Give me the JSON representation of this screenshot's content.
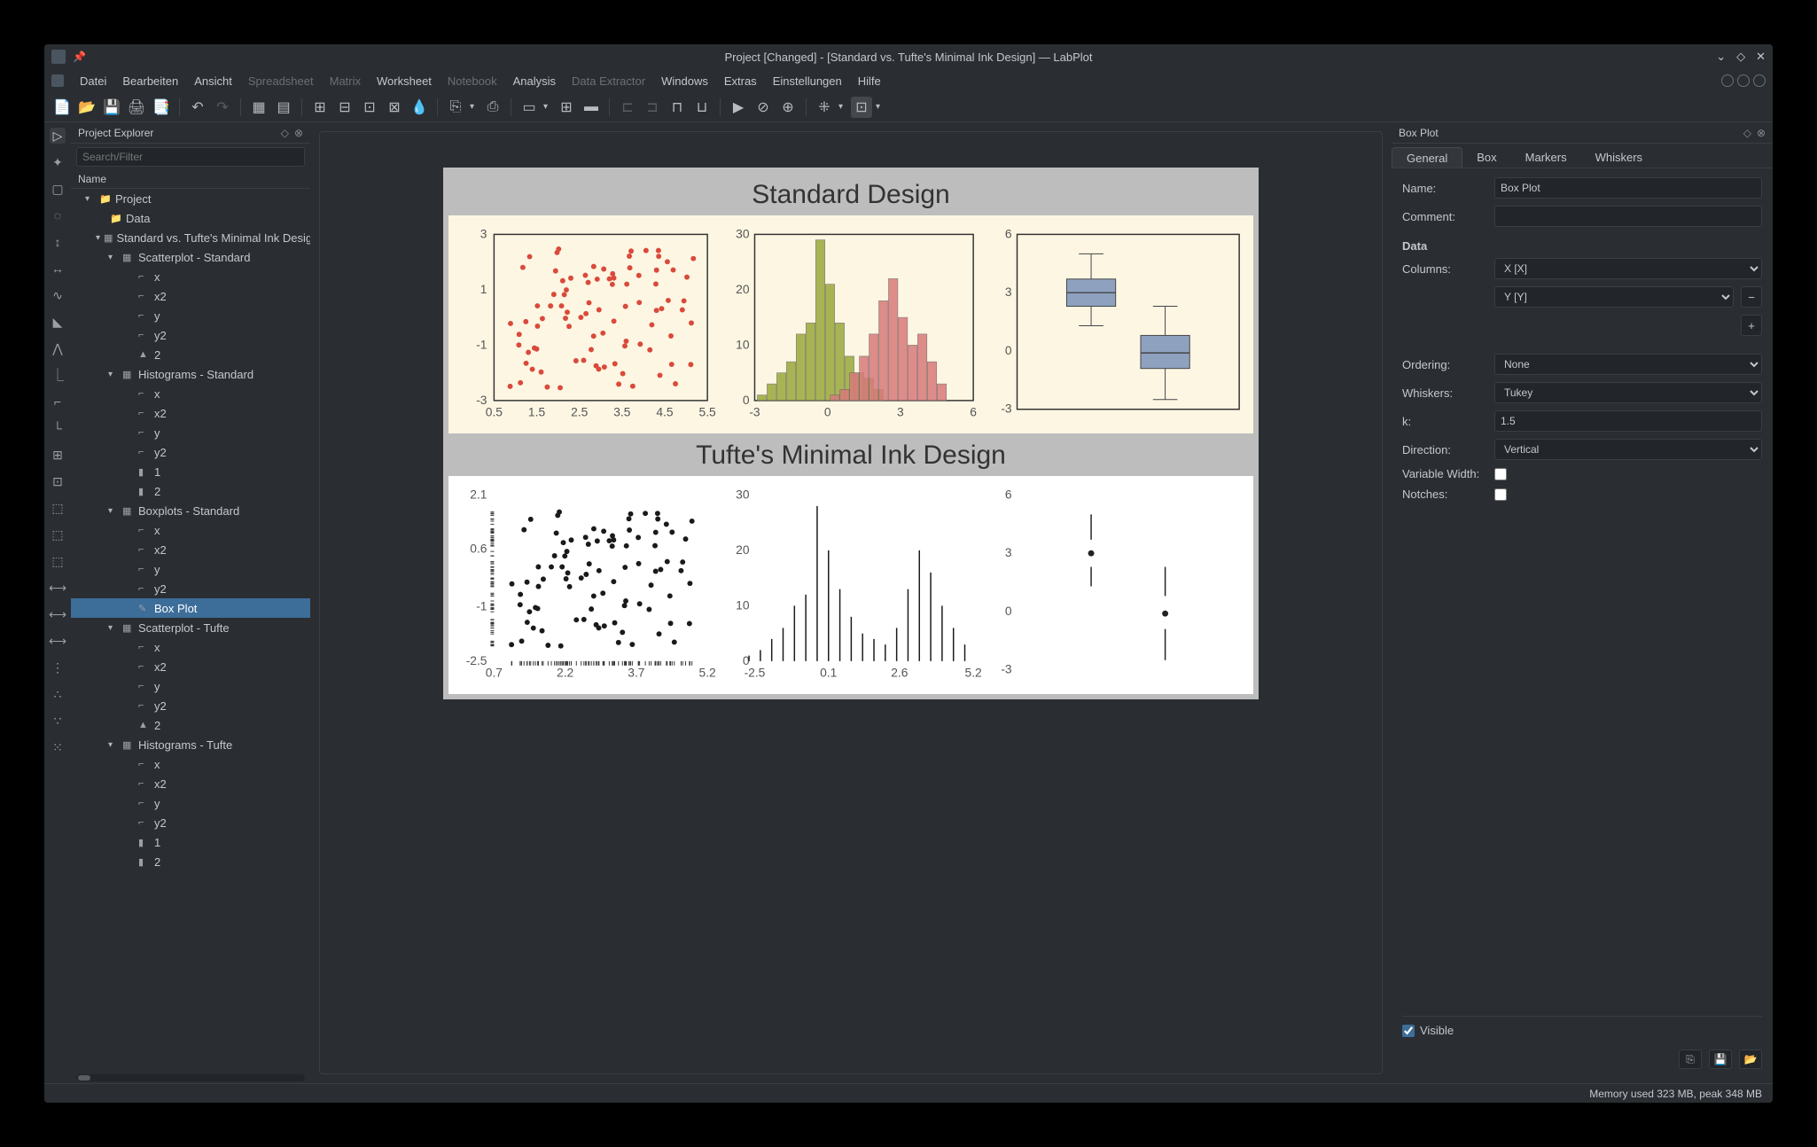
{
  "title": "Project [Changed] - [Standard vs. Tufte's Minimal Ink Design] — LabPlot",
  "menu": {
    "items": [
      "Datei",
      "Bearbeiten",
      "Ansicht",
      "Spreadsheet",
      "Matrix",
      "Worksheet",
      "Notebook",
      "Analysis",
      "Data Extractor",
      "Windows",
      "Extras",
      "Einstellungen",
      "Hilfe"
    ],
    "disabled": [
      3,
      4,
      6,
      8
    ]
  },
  "explorer": {
    "title": "Project Explorer",
    "search_placeholder": "Search/Filter",
    "header": "Name",
    "tree": [
      {
        "l": 1,
        "exp": "▾",
        "ico": "📁",
        "label": "Project"
      },
      {
        "l": 2,
        "exp": "",
        "ico": "📁",
        "label": "Data"
      },
      {
        "l": 2,
        "exp": "▾",
        "ico": "▦",
        "label": "Standard vs. Tufte's Minimal Ink Design"
      },
      {
        "l": 3,
        "exp": "▾",
        "ico": "▦",
        "label": "Scatterplot - Standard"
      },
      {
        "l": 4,
        "exp": "",
        "ico": "⌐",
        "label": "x"
      },
      {
        "l": 4,
        "exp": "",
        "ico": "⌐",
        "label": "x2"
      },
      {
        "l": 4,
        "exp": "",
        "ico": "⌐",
        "label": "y"
      },
      {
        "l": 4,
        "exp": "",
        "ico": "⌐",
        "label": "y2"
      },
      {
        "l": 4,
        "exp": "",
        "ico": "▲",
        "label": "2"
      },
      {
        "l": 3,
        "exp": "▾",
        "ico": "▦",
        "label": "Histograms - Standard"
      },
      {
        "l": 4,
        "exp": "",
        "ico": "⌐",
        "label": "x"
      },
      {
        "l": 4,
        "exp": "",
        "ico": "⌐",
        "label": "x2"
      },
      {
        "l": 4,
        "exp": "",
        "ico": "⌐",
        "label": "y"
      },
      {
        "l": 4,
        "exp": "",
        "ico": "⌐",
        "label": "y2"
      },
      {
        "l": 4,
        "exp": "",
        "ico": "▮",
        "label": "1"
      },
      {
        "l": 4,
        "exp": "",
        "ico": "▮",
        "label": "2"
      },
      {
        "l": 3,
        "exp": "▾",
        "ico": "▦",
        "label": "Boxplots - Standard"
      },
      {
        "l": 4,
        "exp": "",
        "ico": "⌐",
        "label": "x"
      },
      {
        "l": 4,
        "exp": "",
        "ico": "⌐",
        "label": "x2"
      },
      {
        "l": 4,
        "exp": "",
        "ico": "⌐",
        "label": "y"
      },
      {
        "l": 4,
        "exp": "",
        "ico": "⌐",
        "label": "y2"
      },
      {
        "l": 4,
        "exp": "",
        "ico": "✎",
        "label": "Box Plot",
        "selected": true
      },
      {
        "l": 3,
        "exp": "▾",
        "ico": "▦",
        "label": "Scatterplot - Tufte"
      },
      {
        "l": 4,
        "exp": "",
        "ico": "⌐",
        "label": "x"
      },
      {
        "l": 4,
        "exp": "",
        "ico": "⌐",
        "label": "x2"
      },
      {
        "l": 4,
        "exp": "",
        "ico": "⌐",
        "label": "y"
      },
      {
        "l": 4,
        "exp": "",
        "ico": "⌐",
        "label": "y2"
      },
      {
        "l": 4,
        "exp": "",
        "ico": "▲",
        "label": "2"
      },
      {
        "l": 3,
        "exp": "▾",
        "ico": "▦",
        "label": "Histograms - Tufte"
      },
      {
        "l": 4,
        "exp": "",
        "ico": "⌐",
        "label": "x"
      },
      {
        "l": 4,
        "exp": "",
        "ico": "⌐",
        "label": "x2"
      },
      {
        "l": 4,
        "exp": "",
        "ico": "⌐",
        "label": "y"
      },
      {
        "l": 4,
        "exp": "",
        "ico": "⌐",
        "label": "y2"
      },
      {
        "l": 4,
        "exp": "",
        "ico": "▮",
        "label": "1"
      },
      {
        "l": 4,
        "exp": "",
        "ico": "▮",
        "label": "2"
      }
    ]
  },
  "worksheet": {
    "title1": "Standard Design",
    "title2": "Tufte's Minimal Ink Design"
  },
  "chart_data": [
    {
      "type": "scatter",
      "title": "",
      "xlim": [
        0.5,
        5.5
      ],
      "ylim": [
        -3,
        3
      ],
      "xticks": [
        0.5,
        1.5,
        2.5,
        3.5,
        4.5,
        5.5
      ],
      "yticks": [
        -3,
        -1,
        1,
        3
      ],
      "color": "#d94a3a",
      "n": 90
    },
    {
      "type": "bar",
      "title": "",
      "xlim": [
        -3,
        6
      ],
      "ylim": [
        0,
        30
      ],
      "xticks": [
        -3,
        0,
        3,
        6
      ],
      "yticks": [
        0,
        10,
        20,
        30
      ],
      "series": [
        {
          "name": "1",
          "color": "#9aa83a",
          "x": [
            -2.7,
            -2.3,
            -1.9,
            -1.5,
            -1.1,
            -0.7,
            -0.3,
            0.1,
            0.5,
            0.9,
            1.3,
            1.7,
            2.1
          ],
          "values": [
            1,
            3,
            5,
            7,
            12,
            14,
            29,
            21,
            14,
            8,
            5,
            4,
            2
          ]
        },
        {
          "name": "2",
          "color": "#d87a7a",
          "x": [
            0.3,
            0.7,
            1.1,
            1.5,
            1.9,
            2.3,
            2.7,
            3.1,
            3.5,
            3.9,
            4.3,
            4.7
          ],
          "values": [
            1,
            2,
            5,
            8,
            12,
            18,
            22,
            15,
            10,
            12,
            7,
            3
          ]
        }
      ]
    },
    {
      "type": "box",
      "title": "",
      "xlim": [
        0,
        3
      ],
      "ylim": [
        -3,
        6
      ],
      "yticks": [
        -3,
        0,
        3,
        6
      ],
      "boxes": [
        {
          "pos": 1,
          "min": 1.3,
          "q1": 2.3,
          "med": 3.0,
          "q3": 3.7,
          "max": 5.0,
          "color": "#8ea2c0"
        },
        {
          "pos": 2,
          "min": -2.5,
          "q1": -0.9,
          "med": -0.1,
          "q3": 0.8,
          "max": 2.3,
          "color": "#8ea2c0"
        }
      ]
    },
    {
      "type": "scatter",
      "title": "",
      "xlim": [
        0.7,
        5.2
      ],
      "ylim": [
        -2.5,
        2.1
      ],
      "xticks": [
        0.7,
        2.2,
        3.7,
        5.2
      ],
      "yticks": [
        -2.5,
        -1.0,
        0.6,
        2.1
      ],
      "color": "#1a1a1a",
      "n": 90,
      "rug": true
    },
    {
      "type": "bar",
      "title": "",
      "xlim": [
        -2.5,
        5.2
      ],
      "ylim": [
        0,
        30
      ],
      "xticks": [
        -2.5,
        0.1,
        2.6,
        5.2
      ],
      "yticks": [
        0,
        10,
        20,
        30
      ],
      "style": "line",
      "series": [
        {
          "name": "1",
          "color": "#1a1a1a",
          "x": [
            -2.7,
            -2.3,
            -1.9,
            -1.5,
            -1.1,
            -0.7,
            -0.3,
            0.1,
            0.5,
            0.9,
            1.3,
            1.7,
            2.1,
            2.5,
            2.9,
            3.3,
            3.7,
            4.1,
            4.5,
            4.9
          ],
          "values": [
            1,
            2,
            4,
            6,
            10,
            12,
            28,
            20,
            13,
            8,
            5,
            4,
            3,
            6,
            13,
            20,
            16,
            10,
            6,
            3
          ]
        }
      ]
    },
    {
      "type": "box",
      "title": "",
      "xlim": [
        0,
        3
      ],
      "ylim": [
        -3,
        6
      ],
      "yticks": [
        -3,
        0,
        3,
        6
      ],
      "style": "tufte",
      "boxes": [
        {
          "pos": 1,
          "min": 1.3,
          "q1": 2.3,
          "med": 3.0,
          "q3": 3.7,
          "max": 5.0
        },
        {
          "pos": 2,
          "min": -2.5,
          "q1": -0.9,
          "med": -0.1,
          "q3": 0.8,
          "max": 2.3
        }
      ]
    }
  ],
  "props": {
    "title": "Box Plot",
    "tabs": [
      "General",
      "Box",
      "Markers",
      "Whiskers"
    ],
    "active_tab": 0,
    "labels": {
      "name": "Name:",
      "comment": "Comment:",
      "data": "Data",
      "columns": "Columns:",
      "ordering": "Ordering:",
      "whiskers": "Whiskers:",
      "k": "k:",
      "direction": "Direction:",
      "varwidth": "Variable Width:",
      "notches": "Notches:",
      "visible": "Visible"
    },
    "values": {
      "name": "Box Plot",
      "comment": "",
      "col1": "X [X]",
      "col2": "Y [Y]",
      "ordering": "None",
      "whiskers": "Tukey",
      "k": "1.5",
      "direction": "Vertical",
      "varwidth": false,
      "notches": false,
      "visible": true
    }
  },
  "status": "Memory used 323 MB, peak 348 MB"
}
